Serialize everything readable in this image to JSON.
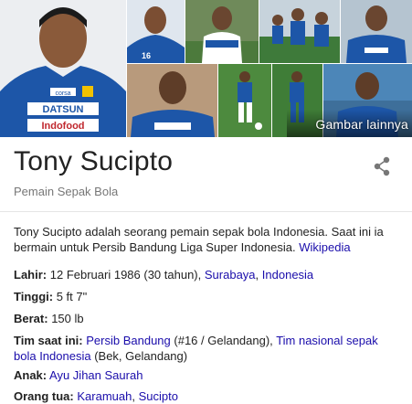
{
  "gallery": {
    "more_label": "Gambar lainnya",
    "photos": [
      {
        "name": "photo-main-portrait"
      },
      {
        "name": "photo-2"
      },
      {
        "name": "photo-3"
      },
      {
        "name": "photo-4"
      },
      {
        "name": "photo-5"
      },
      {
        "name": "photo-6"
      },
      {
        "name": "photo-7"
      },
      {
        "name": "photo-8"
      },
      {
        "name": "photo-9"
      },
      {
        "name": "photo-10"
      }
    ],
    "jersey_texts": {
      "corsa": "corsa",
      "datsun": "DATSUN",
      "indofood": "Indofood",
      "number": "16"
    }
  },
  "entity": {
    "title": "Tony Sucipto",
    "subtitle": "Pemain Sepak Bola",
    "share_icon": "share-icon"
  },
  "description": {
    "text": "Tony Sucipto adalah seorang pemain sepak bola Indonesia. Saat ini ia bermain untuk Persib Bandung Liga Super Indonesia.",
    "source_link": "Wikipedia"
  },
  "facts": {
    "lahir": {
      "label": "Lahir:",
      "value": "12 Februari 1986 (30 tahun),",
      "link1": "Surabaya",
      "sep": ",",
      "link2": "Indonesia"
    },
    "tinggi": {
      "label": "Tinggi:",
      "value": "5 ft 7\""
    },
    "berat": {
      "label": "Berat:",
      "value": "150 lb"
    },
    "tim": {
      "label": "Tim saat ini:",
      "link1": "Persib Bandung",
      "value1": "(#16 / Gelandang),",
      "link2": "Tim nasional sepak bola Indonesia",
      "value2": "(Bek, Gelandang)"
    },
    "anak": {
      "label": "Anak:",
      "link1": "Ayu Jihan Saurah"
    },
    "orang_tua": {
      "label": "Orang tua:",
      "link1": "Karamuah",
      "sep": ",",
      "link2": "Sucipto"
    }
  },
  "colors": {
    "link": "#1a0dab",
    "jersey_blue": "#1d56a8",
    "title": "#222222",
    "subtitle": "#777777"
  }
}
